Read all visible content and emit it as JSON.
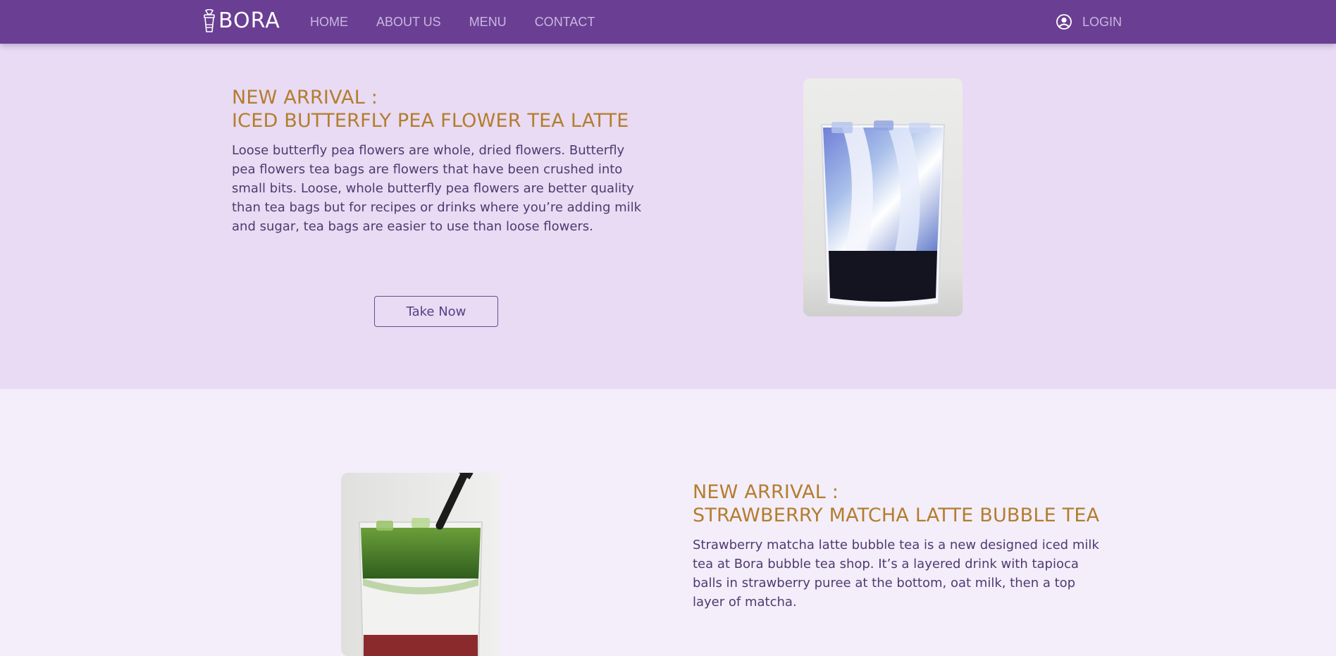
{
  "nav": {
    "logo_text": "BORA",
    "links": [
      "HOME",
      "ABOUT US",
      "MENU",
      "CONTACT"
    ],
    "login_label": "LOGIN"
  },
  "colors": {
    "navbar": "#6a3f93",
    "section1_bg": "#e8dbf3",
    "section2_bg": "#f3eefa",
    "heading": "#b47d2e",
    "body_text": "#4f3a70"
  },
  "product1": {
    "heading_line1": "NEW ARRIVAL :",
    "heading_line2": "ICED BUTTERFLY PEA FLOWER TEA LATTE",
    "description": "Loose butterfly pea flowers are whole, dried flowers. Butterfly pea flowers tea bags are flowers that have been crushed into small bits. Loose, whole butterfly pea flowers are better quality than tea bags but for recipes or drinks where you’re adding milk and sugar, tea bags are easier to use than loose flowers.",
    "button_label": "Take Now"
  },
  "product2": {
    "heading_line1": "NEW ARRIVAL :",
    "heading_line2": "STRAWBERRY MATCHA LATTE BUBBLE TEA",
    "description": "Strawberry matcha latte bubble tea is a new designed iced milk tea at Bora bubble tea shop. It’s a layered drink with tapioca balls in strawberry puree at the bottom, oat milk, then a top layer of matcha."
  }
}
